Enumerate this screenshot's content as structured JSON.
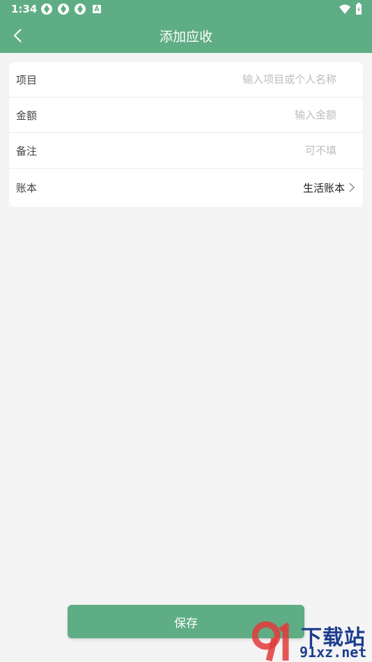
{
  "status_bar": {
    "time": "1:34"
  },
  "header": {
    "title": "添加应收"
  },
  "form": {
    "rows": [
      {
        "label": "项目",
        "placeholder": "输入项目或个人名称"
      },
      {
        "label": "金额",
        "placeholder": "输入金额"
      },
      {
        "label": "备注",
        "placeholder": "可不填"
      },
      {
        "label": "账本",
        "value": "生活账本"
      }
    ]
  },
  "footer": {
    "save_label": "保存"
  },
  "watermark": {
    "text_main": "下载站",
    "text_site": "91xz.net"
  },
  "colors": {
    "accent": "#5fad85",
    "background": "#f4f4f4"
  }
}
